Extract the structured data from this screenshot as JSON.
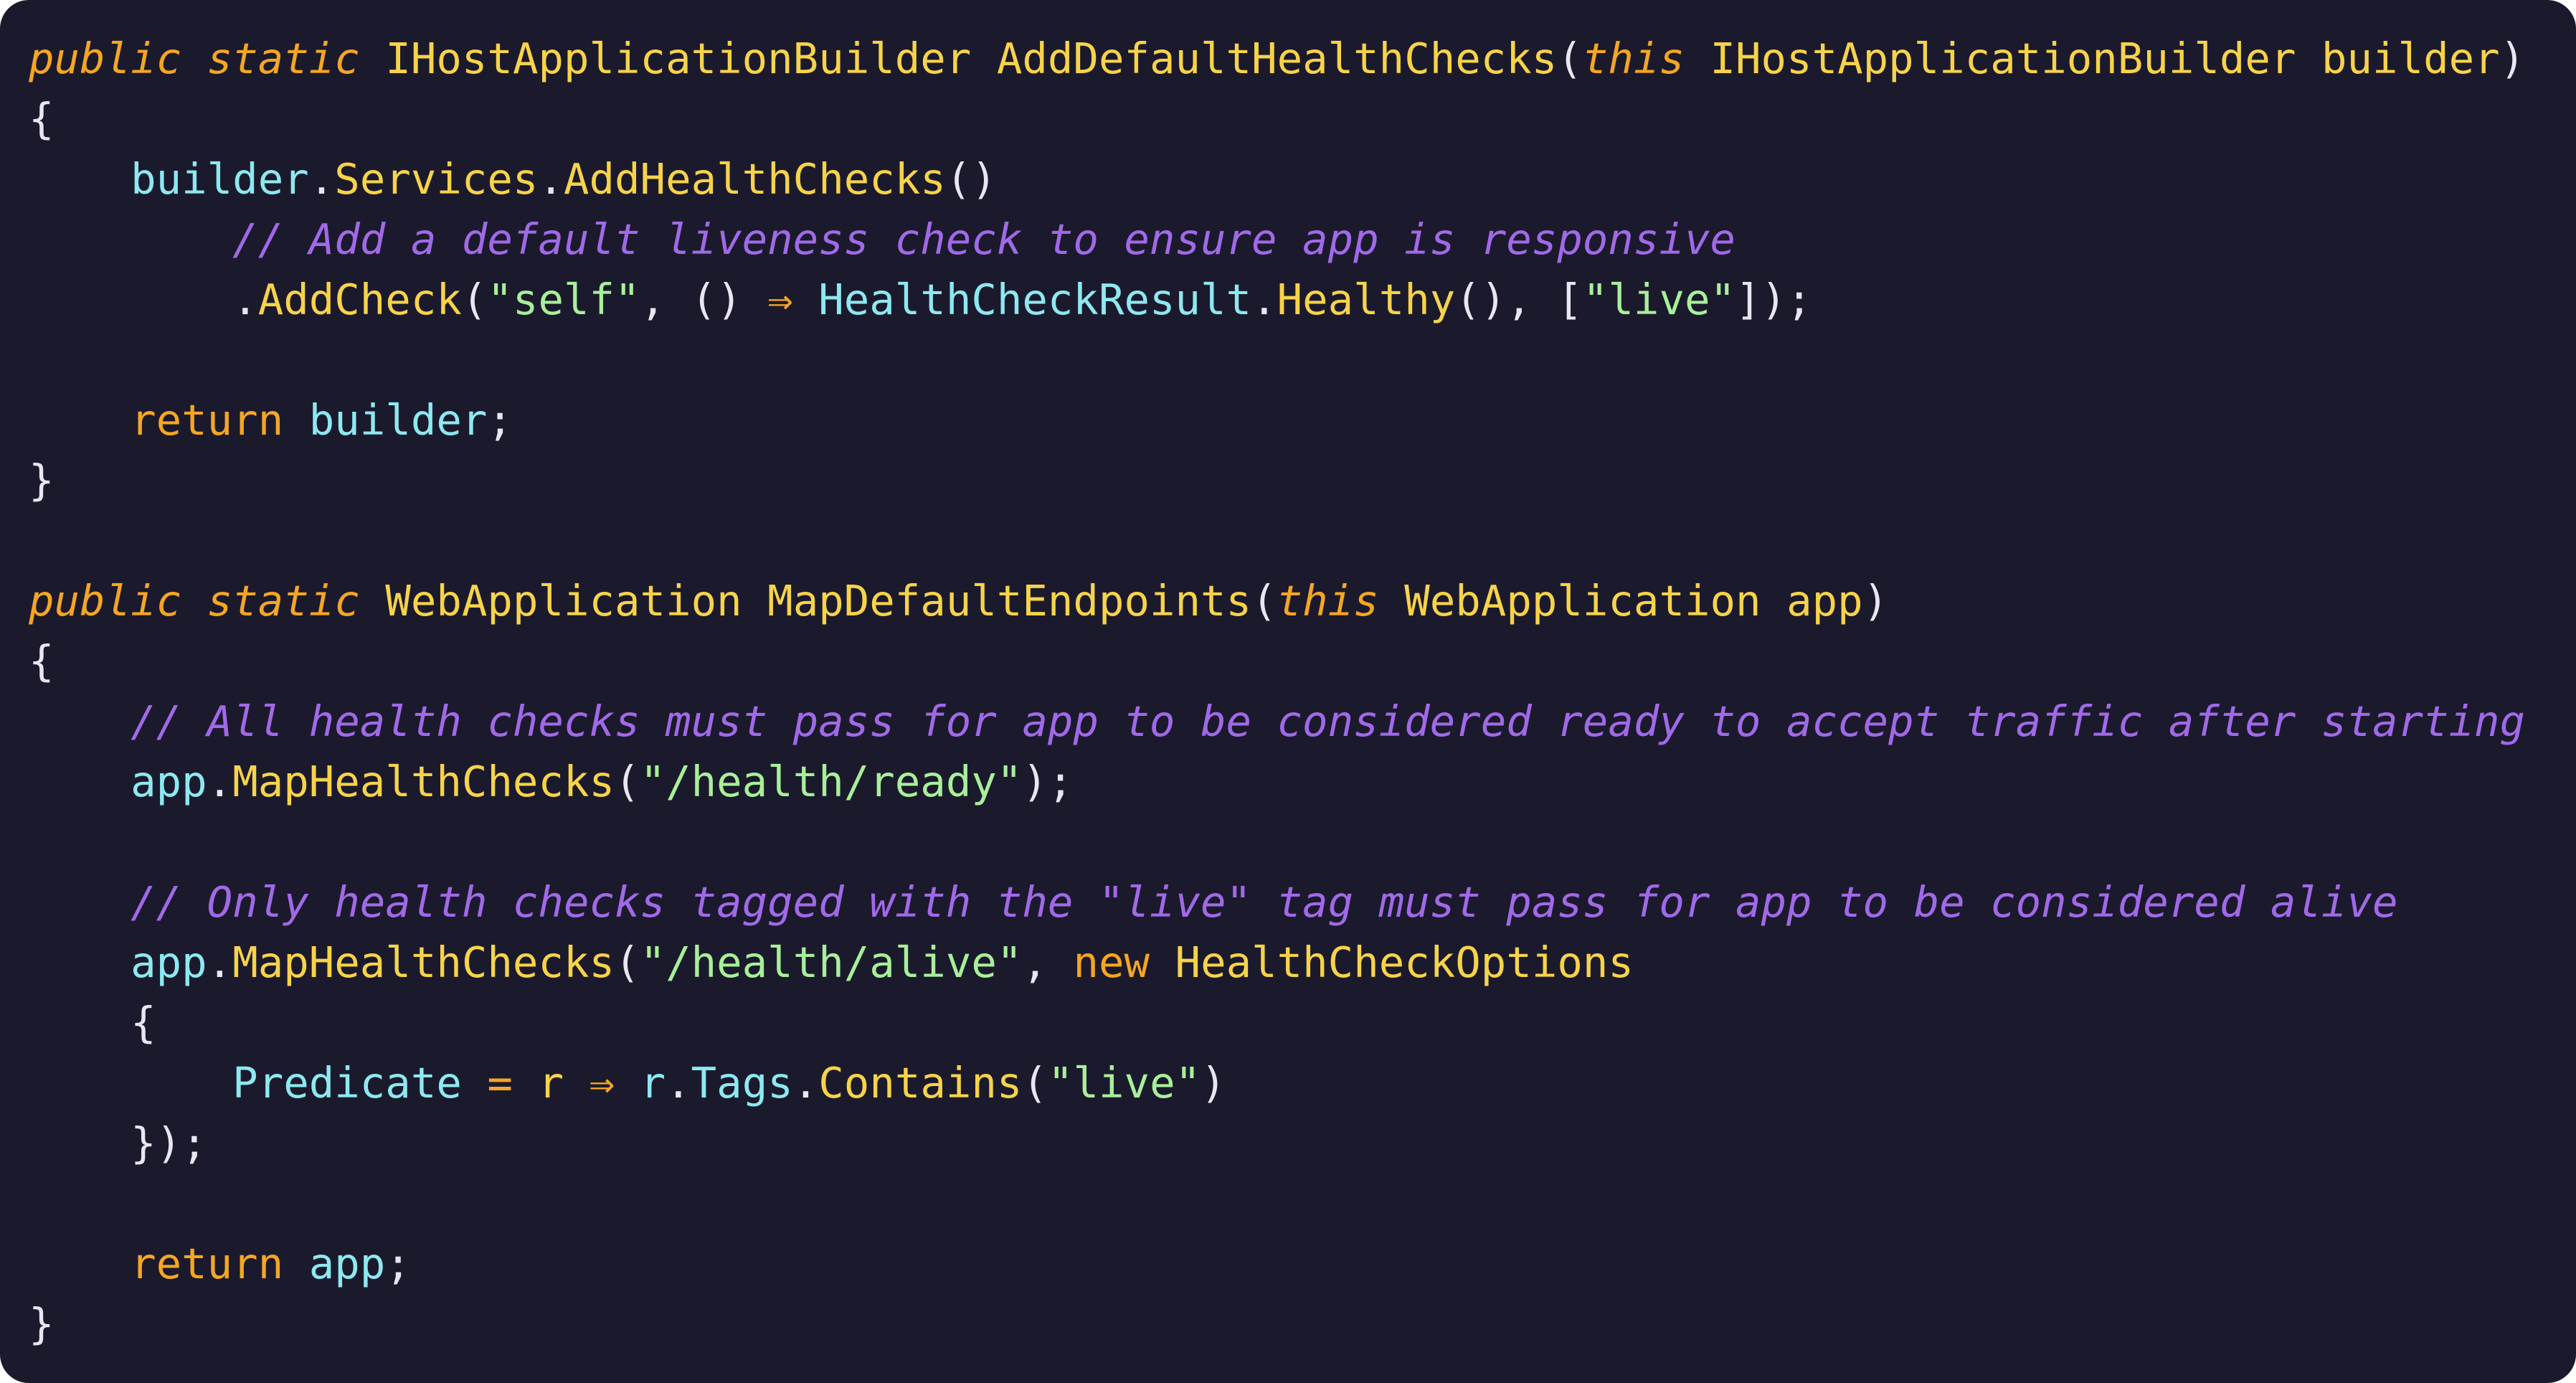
{
  "colors": {
    "background": "#1b1a2d",
    "keyword": "#f5a623",
    "type": "#f7d34a",
    "identifier": "#8ee8f0",
    "punctuation": "#e9e6f2",
    "string": "#a9ef9a",
    "comment": "#a169e8"
  },
  "code": {
    "language": "csharp",
    "lines": [
      [
        {
          "t": "public",
          "k": "keyword",
          "i": true
        },
        {
          "t": " ",
          "k": "punctuation"
        },
        {
          "t": "static",
          "k": "keyword",
          "i": true
        },
        {
          "t": " ",
          "k": "punctuation"
        },
        {
          "t": "IHostApplicationBuilder",
          "k": "type"
        },
        {
          "t": " ",
          "k": "punctuation"
        },
        {
          "t": "AddDefaultHealthChecks",
          "k": "type"
        },
        {
          "t": "(",
          "k": "punctuation"
        },
        {
          "t": "this",
          "k": "keyword",
          "i": true
        },
        {
          "t": " ",
          "k": "punctuation"
        },
        {
          "t": "IHostApplicationBuilder",
          "k": "type"
        },
        {
          "t": " ",
          "k": "punctuation"
        },
        {
          "t": "builder",
          "k": "type"
        },
        {
          "t": ")",
          "k": "punctuation"
        }
      ],
      [
        {
          "t": "{",
          "k": "punctuation"
        }
      ],
      [
        {
          "t": "    ",
          "k": "punctuation"
        },
        {
          "t": "builder",
          "k": "identifier"
        },
        {
          "t": ".",
          "k": "punctuation"
        },
        {
          "t": "Services",
          "k": "type"
        },
        {
          "t": ".",
          "k": "punctuation"
        },
        {
          "t": "AddHealthChecks",
          "k": "type"
        },
        {
          "t": "()",
          "k": "punctuation"
        }
      ],
      [
        {
          "t": "        ",
          "k": "punctuation"
        },
        {
          "t": "// Add a default liveness check to ensure app is responsive",
          "k": "comment",
          "i": true
        }
      ],
      [
        {
          "t": "        ",
          "k": "punctuation"
        },
        {
          "t": ".",
          "k": "punctuation"
        },
        {
          "t": "AddCheck",
          "k": "type"
        },
        {
          "t": "(",
          "k": "punctuation"
        },
        {
          "t": "\"self\"",
          "k": "string"
        },
        {
          "t": ", () ",
          "k": "punctuation"
        },
        {
          "t": "⇒",
          "k": "keyword"
        },
        {
          "t": " ",
          "k": "punctuation"
        },
        {
          "t": "HealthCheckResult",
          "k": "identifier"
        },
        {
          "t": ".",
          "k": "punctuation"
        },
        {
          "t": "Healthy",
          "k": "type"
        },
        {
          "t": "(), [",
          "k": "punctuation"
        },
        {
          "t": "\"live\"",
          "k": "string"
        },
        {
          "t": "]);",
          "k": "punctuation"
        }
      ],
      [],
      [
        {
          "t": "    ",
          "k": "punctuation"
        },
        {
          "t": "return",
          "k": "keyword"
        },
        {
          "t": " ",
          "k": "punctuation"
        },
        {
          "t": "builder",
          "k": "identifier"
        },
        {
          "t": ";",
          "k": "punctuation"
        }
      ],
      [
        {
          "t": "}",
          "k": "punctuation"
        }
      ],
      [],
      [
        {
          "t": "public",
          "k": "keyword",
          "i": true
        },
        {
          "t": " ",
          "k": "punctuation"
        },
        {
          "t": "static",
          "k": "keyword",
          "i": true
        },
        {
          "t": " ",
          "k": "punctuation"
        },
        {
          "t": "WebApplication",
          "k": "type"
        },
        {
          "t": " ",
          "k": "punctuation"
        },
        {
          "t": "MapDefaultEndpoints",
          "k": "type"
        },
        {
          "t": "(",
          "k": "punctuation"
        },
        {
          "t": "this",
          "k": "keyword",
          "i": true
        },
        {
          "t": " ",
          "k": "punctuation"
        },
        {
          "t": "WebApplication",
          "k": "type"
        },
        {
          "t": " ",
          "k": "punctuation"
        },
        {
          "t": "app",
          "k": "type"
        },
        {
          "t": ")",
          "k": "punctuation"
        }
      ],
      [
        {
          "t": "{",
          "k": "punctuation"
        }
      ],
      [
        {
          "t": "    ",
          "k": "punctuation"
        },
        {
          "t": "// All health checks must pass for app to be considered ready to accept traffic after starting",
          "k": "comment",
          "i": true
        }
      ],
      [
        {
          "t": "    ",
          "k": "punctuation"
        },
        {
          "t": "app",
          "k": "identifier"
        },
        {
          "t": ".",
          "k": "punctuation"
        },
        {
          "t": "MapHealthChecks",
          "k": "type"
        },
        {
          "t": "(",
          "k": "punctuation"
        },
        {
          "t": "\"/health/ready\"",
          "k": "string"
        },
        {
          "t": ");",
          "k": "punctuation"
        }
      ],
      [],
      [
        {
          "t": "    ",
          "k": "punctuation"
        },
        {
          "t": "// Only health checks tagged with the \"live\" tag must pass for app to be considered alive",
          "k": "comment",
          "i": true
        }
      ],
      [
        {
          "t": "    ",
          "k": "punctuation"
        },
        {
          "t": "app",
          "k": "identifier"
        },
        {
          "t": ".",
          "k": "punctuation"
        },
        {
          "t": "MapHealthChecks",
          "k": "type"
        },
        {
          "t": "(",
          "k": "punctuation"
        },
        {
          "t": "\"/health/alive\"",
          "k": "string"
        },
        {
          "t": ", ",
          "k": "punctuation"
        },
        {
          "t": "new",
          "k": "keyword"
        },
        {
          "t": " ",
          "k": "punctuation"
        },
        {
          "t": "HealthCheckOptions",
          "k": "type"
        }
      ],
      [
        {
          "t": "    ",
          "k": "punctuation"
        },
        {
          "t": "{",
          "k": "punctuation"
        }
      ],
      [
        {
          "t": "        ",
          "k": "punctuation"
        },
        {
          "t": "Predicate",
          "k": "identifier"
        },
        {
          "t": " ",
          "k": "punctuation"
        },
        {
          "t": "=",
          "k": "keyword"
        },
        {
          "t": " ",
          "k": "punctuation"
        },
        {
          "t": "r",
          "k": "type"
        },
        {
          "t": " ",
          "k": "punctuation"
        },
        {
          "t": "⇒",
          "k": "keyword"
        },
        {
          "t": " ",
          "k": "punctuation"
        },
        {
          "t": "r",
          "k": "identifier"
        },
        {
          "t": ".",
          "k": "punctuation"
        },
        {
          "t": "Tags",
          "k": "identifier"
        },
        {
          "t": ".",
          "k": "punctuation"
        },
        {
          "t": "Contains",
          "k": "type"
        },
        {
          "t": "(",
          "k": "punctuation"
        },
        {
          "t": "\"live\"",
          "k": "string"
        },
        {
          "t": ")",
          "k": "punctuation"
        }
      ],
      [
        {
          "t": "    ",
          "k": "punctuation"
        },
        {
          "t": "});",
          "k": "punctuation"
        }
      ],
      [],
      [
        {
          "t": "    ",
          "k": "punctuation"
        },
        {
          "t": "return",
          "k": "keyword"
        },
        {
          "t": " ",
          "k": "punctuation"
        },
        {
          "t": "app",
          "k": "identifier"
        },
        {
          "t": ";",
          "k": "punctuation"
        }
      ],
      [
        {
          "t": "}",
          "k": "punctuation"
        }
      ]
    ]
  }
}
